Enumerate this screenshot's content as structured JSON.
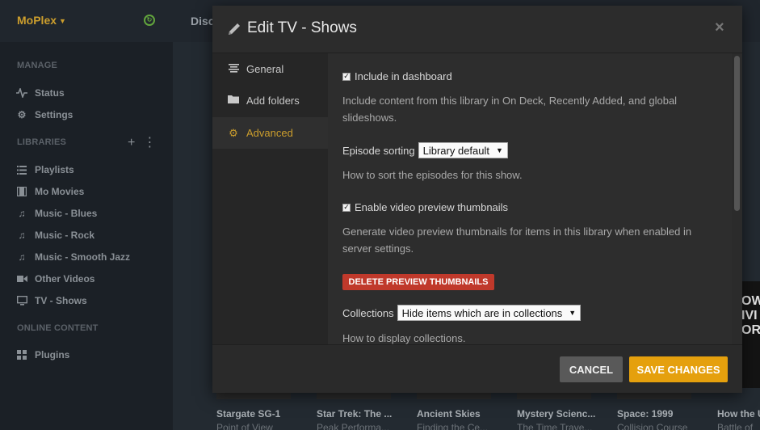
{
  "app": {
    "server_name": "MoPlex",
    "nav_partial": "Disc"
  },
  "sidebar": {
    "manage_title": "MANAGE",
    "manage_items": [
      {
        "label": "Status",
        "icon": "pulse-icon"
      },
      {
        "label": "Settings",
        "icon": "gear-icon"
      }
    ],
    "libraries_title": "LIBRARIES",
    "library_items": [
      {
        "label": "Playlists",
        "icon": "list-icon"
      },
      {
        "label": "Mo Movies",
        "icon": "film-icon"
      },
      {
        "label": "Music - Blues",
        "icon": "music-note-icon"
      },
      {
        "label": "Music - Rock",
        "icon": "music-note-icon"
      },
      {
        "label": "Music - Smooth Jazz",
        "icon": "music-note-icon"
      },
      {
        "label": "Other Videos",
        "icon": "video-camera-icon"
      },
      {
        "label": "TV - Shows",
        "icon": "monitor-icon"
      }
    ],
    "online_title": "ONLINE CONTENT",
    "online_items": [
      {
        "label": "Plugins",
        "icon": "grid-icon"
      }
    ]
  },
  "background_cards": [
    {
      "title": "Stargate SG-1",
      "subtitle": "Point of View"
    },
    {
      "title": "Star Trek: The ...",
      "subtitle": "Peak Performa..."
    },
    {
      "title": "Ancient Skies",
      "subtitle": "Finding the Ce..."
    },
    {
      "title": "Mystery Scienc...",
      "subtitle": "The Time Trave..."
    },
    {
      "title": "Space: 1999",
      "subtitle": "Collision Course"
    },
    {
      "title": "How the U",
      "subtitle": "Battle of"
    }
  ],
  "side_poster_text": "OW IVI ORI",
  "modal": {
    "title": "Edit TV - Shows",
    "close_symbol": "×",
    "nav": [
      {
        "label": "General",
        "icon": "lines-icon",
        "active": false
      },
      {
        "label": "Add folders",
        "icon": "folder-icon",
        "active": false
      },
      {
        "label": "Advanced",
        "icon": "gear-icon",
        "active": true
      }
    ],
    "content": {
      "include_dashboard_label": "Include in dashboard",
      "include_dashboard_checked": true,
      "include_dashboard_help": "Include content from this library in On Deck, Recently Added, and global slideshows.",
      "episode_sorting_label": "Episode sorting",
      "episode_sorting_value": "Library default",
      "episode_sorting_help": "How to sort the episodes for this show.",
      "video_preview_label": "Enable video preview thumbnails",
      "video_preview_checked": true,
      "video_preview_help": "Generate video preview thumbnails for items in this library when enabled in server settings.",
      "delete_thumbnails_label": "DELETE PREVIEW THUMBNAILS",
      "collections_label": "Collections",
      "collections_value": "Hide items which are in collections",
      "collections_help": "How to display collections."
    },
    "footer": {
      "cancel_label": "CANCEL",
      "save_label": "SAVE CHANGES"
    }
  },
  "colors": {
    "accent": "#cc9e2d",
    "save": "#e5a00d",
    "danger": "#c0392b"
  }
}
